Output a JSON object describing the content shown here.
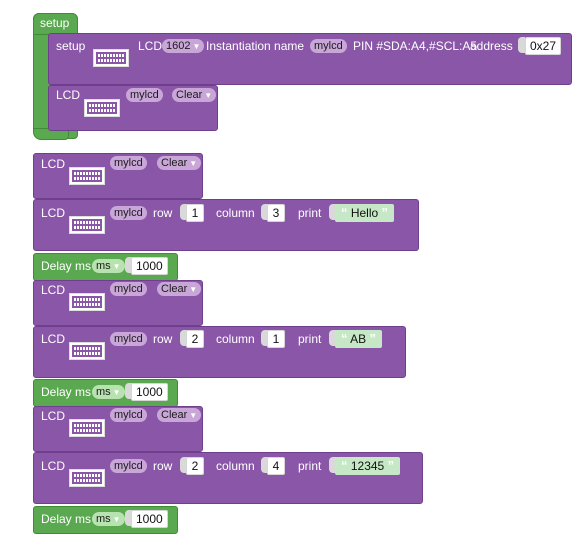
{
  "setup": {
    "label": "setup",
    "init_block": {
      "label": "setup",
      "lcd_label": "LCD",
      "model": "1602",
      "inst_label": "Instantiation name",
      "inst_name": "mylcd",
      "pin_text": "PIN #SDA:A4,#SCL:A5",
      "address_label": "address",
      "address_value": "0x27"
    },
    "clear_block": {
      "lcd_label": "LCD",
      "name": "mylcd",
      "action": "Clear"
    }
  },
  "sequence": [
    {
      "clear": {
        "lcd_label": "LCD",
        "name": "mylcd",
        "action": "Clear"
      },
      "print": {
        "lcd_label": "LCD",
        "name": "mylcd",
        "row_label": "row",
        "row": "1",
        "column_label": "column",
        "column": "3",
        "print_label": "print",
        "text": "Hello"
      },
      "delay": {
        "label": "Delay ms",
        "unit": "ms",
        "value": "1000"
      }
    },
    {
      "clear": {
        "lcd_label": "LCD",
        "name": "mylcd",
        "action": "Clear"
      },
      "print": {
        "lcd_label": "LCD",
        "name": "mylcd",
        "row_label": "row",
        "row": "2",
        "column_label": "column",
        "column": "1",
        "print_label": "print",
        "text": "AB"
      },
      "delay": {
        "label": "Delay ms",
        "unit": "ms",
        "value": "1000"
      }
    },
    {
      "clear": {
        "lcd_label": "LCD",
        "name": "mylcd",
        "action": "Clear"
      },
      "print": {
        "lcd_label": "LCD",
        "name": "mylcd",
        "row_label": "row",
        "row": "2",
        "column_label": "column",
        "column": "4",
        "print_label": "print",
        "text": "12345"
      },
      "delay": {
        "label": "Delay ms",
        "unit": "ms",
        "value": "1000"
      }
    }
  ],
  "icons": {
    "lcd": "lcd-display-icon",
    "dropdown": "dropdown-arrow-icon",
    "quote": "quote-mark-icon"
  },
  "colors": {
    "lcd_block": "#8a57a8",
    "control_block": "#5aa850",
    "field_pill": "#c9a6d8",
    "string_field": "#c7e8c6"
  }
}
